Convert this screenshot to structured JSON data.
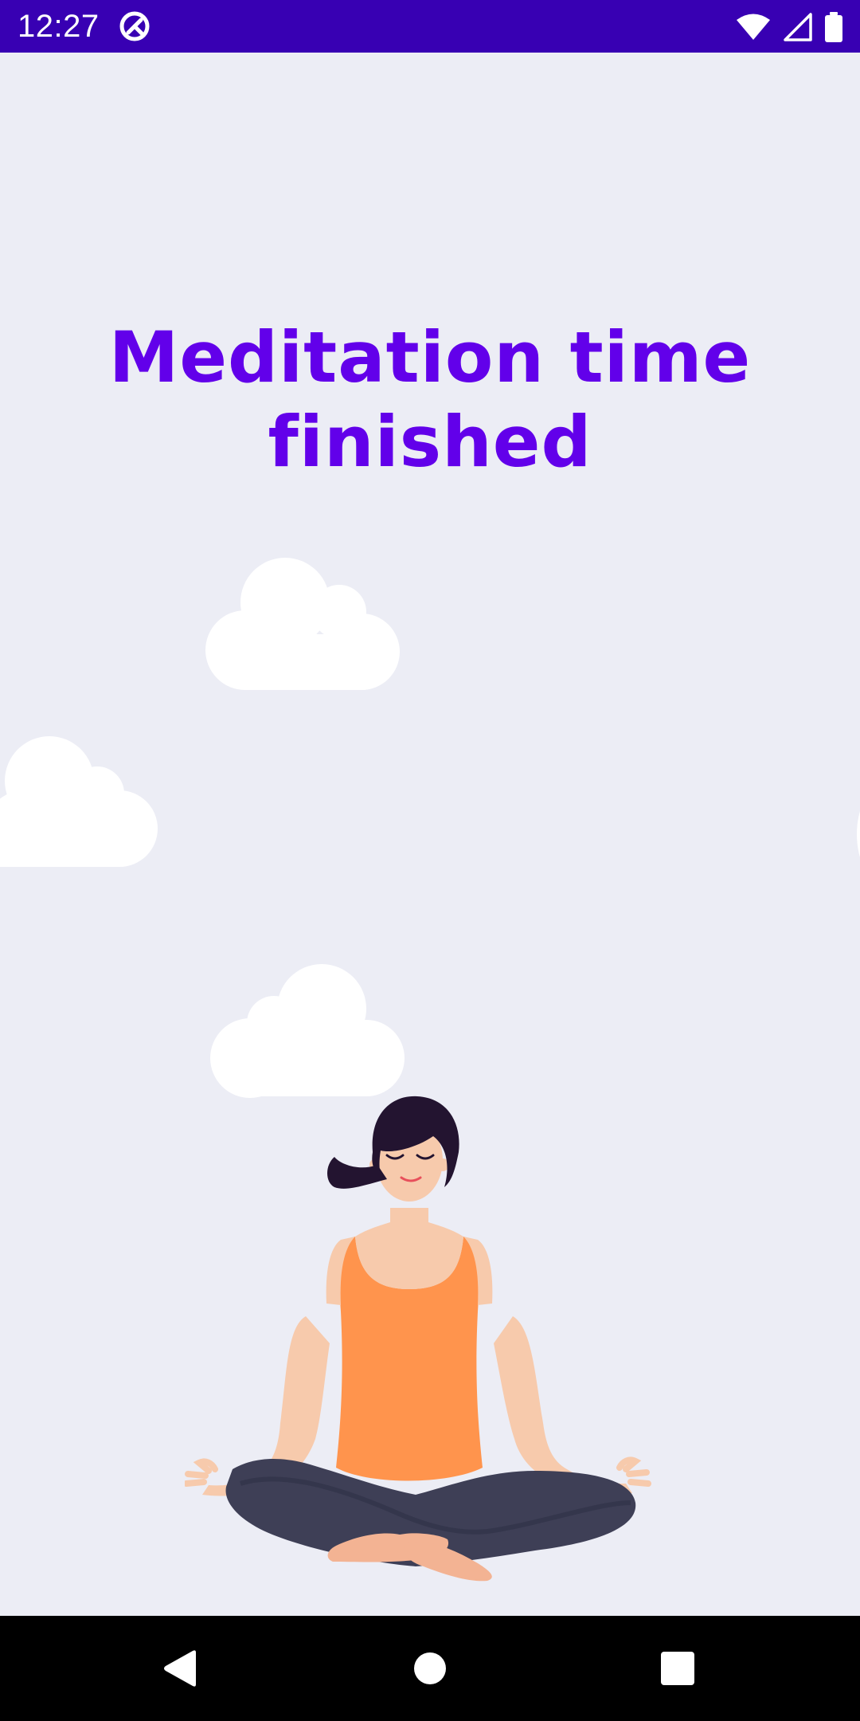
{
  "status_bar": {
    "time": "12:27",
    "app_icon": "at-sign-icon",
    "wifi_icon": "wifi-icon",
    "signal_icon": "cellular-signal-icon",
    "battery_icon": "battery-icon",
    "background_color": "#3800B3"
  },
  "main": {
    "title_line1": "Meditation time",
    "title_line2": "finished",
    "title_color": "#6200EA",
    "background_color": "#ECEDF5",
    "illustration": "meditating-woman-illustration",
    "clouds": [
      "cloud-icon",
      "cloud-icon",
      "cloud-icon",
      "cloud-icon"
    ]
  },
  "nav_bar": {
    "back_icon": "back-icon",
    "home_icon": "home-icon",
    "recents_icon": "recents-icon"
  }
}
